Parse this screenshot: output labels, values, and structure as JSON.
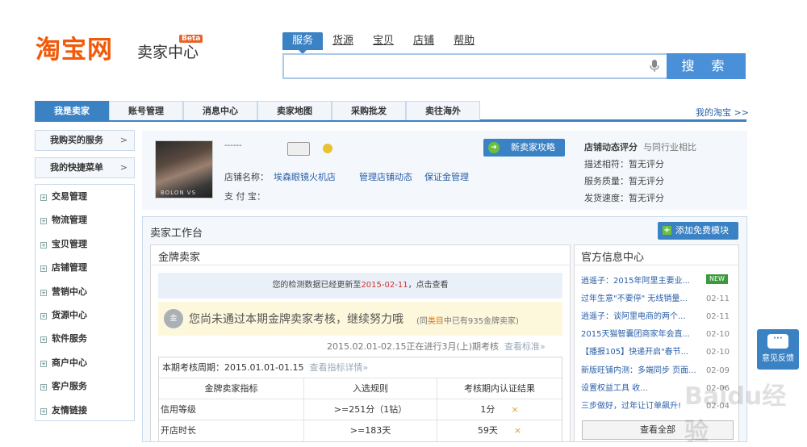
{
  "header": {
    "logo": "淘宝网",
    "logo_sub": "卖家中心",
    "beta": "Beta",
    "search_tabs": [
      "服务",
      "货源",
      "宝贝",
      "店铺",
      "帮助"
    ],
    "search_value": "",
    "search_button": "搜 索"
  },
  "nav": {
    "items": [
      "我是卖家",
      "账号管理",
      "消息中心",
      "卖家地图",
      "采购批发",
      "卖往海外"
    ],
    "my_taobao": "我的淘宝 >>"
  },
  "sidebar": {
    "bought_services": "我购买的服务",
    "quick_menu": "我的快捷菜单",
    "arrow": ">",
    "items": [
      "交易管理",
      "物流管理",
      "宝贝管理",
      "店铺管理",
      "营销中心",
      "货源中心",
      "软件服务",
      "商户中心",
      "客户服务",
      "友情链接"
    ]
  },
  "user": {
    "masked": "------",
    "avatar_text": "BOLON VS",
    "shop_label": "店铺名称：",
    "shop_name": "埃森眼镜火机店",
    "manage_link": "管理店铺动态",
    "deposit_link": "保证金管理",
    "alipay_label": "支 付 宝：",
    "new_seller_btn": "新卖家攻略"
  },
  "rating": {
    "title": "店铺动态评分",
    "compare": "与同行业相比",
    "rows": [
      "描述相符：暂无评分",
      "服务质量：暂无评分",
      "发货速度：暂无评分"
    ]
  },
  "workbench": {
    "title": "卖家工作台",
    "add_module": "添加免费模块"
  },
  "gold": {
    "title": "金牌卖家",
    "notice_pre": "您的检测数据已经更新至",
    "notice_date": "2015-02-11",
    "notice_post": "，点击查看",
    "medal": "金",
    "warn": "您尚未通过本期金牌卖家考核，继续努力哦",
    "warn2_pre": "(同",
    "warn2_cat": "类目",
    "warn2_post": "中已有935金牌卖家)",
    "period_text": "2015.02.01-02.15正在进行3月(上)期考核",
    "period_link": "查看标准»",
    "cycle_label": "本期考核周期：",
    "cycle_value": "2015.01.01-01.15",
    "cycle_link": "查看指标详情»",
    "table_headers": [
      "金牌卖家指标",
      "入选规则",
      "考核期内认证结果"
    ],
    "rows": [
      {
        "name": "信用等级",
        "rule": ">=251分（1钻）",
        "result": "1分",
        "mark": "×"
      },
      {
        "name": "开店时长",
        "rule": ">=183天",
        "result": "59天",
        "mark": "×"
      }
    ]
  },
  "official": {
    "title": "官方信息中心",
    "new_tag": "NEW",
    "news": [
      {
        "title": "逍遥子：2015年阿里主要业...",
        "date": ""
      },
      {
        "title": "过年生意\"不要停\" 无线销量...",
        "date": "02-11"
      },
      {
        "title": "逍遥子：谈阿里电商的两个...",
        "date": "02-11"
      },
      {
        "title": "2015天猫智囊团商家年会直...",
        "date": "02-10"
      },
      {
        "title": "【播报105】快递开启\"春节...",
        "date": "02-10"
      },
      {
        "title": "新版旺铺内测：多端同步 页面...",
        "date": "02-09"
      },
      {
        "title": "设置权益工具 收...",
        "date": "02-06"
      },
      {
        "title": "三步做好，过年让订单飙升!",
        "date": "02-04"
      }
    ],
    "view_all": "查看全部"
  },
  "feedback": {
    "label": "意见反馈"
  },
  "watermark": "Baidu经验"
}
